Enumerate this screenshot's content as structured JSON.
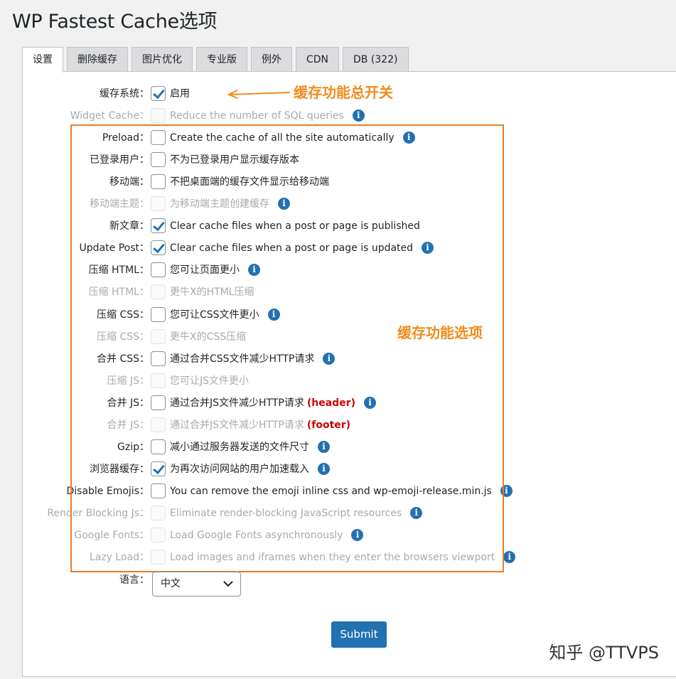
{
  "title": "WP Fastest Cache选项",
  "tabs": [
    {
      "label": "设置",
      "active": true
    },
    {
      "label": "删除缓存"
    },
    {
      "label": "图片优化"
    },
    {
      "label": "专业版"
    },
    {
      "label": "例外"
    },
    {
      "label": "CDN"
    },
    {
      "label": "DB (322)"
    }
  ],
  "rows": [
    {
      "label": "缓存系统：",
      "desc": "启用",
      "checked": true,
      "info": false,
      "disabled": false
    },
    {
      "label": "Widget Cache：",
      "desc": "Reduce the number of SQL queries",
      "checked": false,
      "info": true,
      "disabled": true
    },
    {
      "label": "Preload：",
      "desc": "Create the cache of all the site automatically",
      "checked": false,
      "info": true,
      "disabled": false
    },
    {
      "label": "已登录用户：",
      "desc": "不为已登录用户显示缓存版本",
      "checked": false,
      "info": false,
      "disabled": false
    },
    {
      "label": "移动端：",
      "desc": "不把桌面端的缓存文件显示给移动端",
      "checked": false,
      "info": false,
      "disabled": false
    },
    {
      "label": "移动端主题：",
      "desc": "为移动端主题创建缓存",
      "checked": false,
      "info": true,
      "disabled": true
    },
    {
      "label": "新文章：",
      "desc": "Clear cache files when a post or page is published",
      "checked": true,
      "info": false,
      "disabled": false
    },
    {
      "label": "Update Post：",
      "desc": "Clear cache files when a post or page is updated",
      "checked": true,
      "info": true,
      "disabled": false
    },
    {
      "label": "压缩 HTML：",
      "desc": "您可让页面更小",
      "checked": false,
      "info": true,
      "disabled": false
    },
    {
      "label": "压缩 HTML：",
      "desc": "更牛X的HTML压缩",
      "checked": false,
      "info": false,
      "disabled": true
    },
    {
      "label": "压缩 CSS：",
      "desc": "您可让CSS文件更小",
      "checked": false,
      "info": true,
      "disabled": false
    },
    {
      "label": "压缩 CSS：",
      "desc": "更牛X的CSS压缩",
      "checked": false,
      "info": false,
      "disabled": true
    },
    {
      "label": "合并 CSS：",
      "desc": "通过合并CSS文件减少HTTP请求",
      "checked": false,
      "info": true,
      "disabled": false
    },
    {
      "label": "压缩 JS：",
      "desc": "您可让JS文件更小",
      "checked": false,
      "info": false,
      "disabled": true
    },
    {
      "label": "合并 JS：",
      "desc": "通过合并JS文件减少HTTP请求",
      "tag": "(header)",
      "checked": false,
      "info": true,
      "disabled": false
    },
    {
      "label": "合并 JS：",
      "desc": "通过合并JS文件减少HTTP请求",
      "tag": "(footer)",
      "checked": false,
      "info": false,
      "disabled": true
    },
    {
      "label": "Gzip：",
      "desc": "减小通过服务器发送的文件尺寸",
      "checked": false,
      "info": true,
      "disabled": false
    },
    {
      "label": "浏览器缓存：",
      "desc": "为再次访问网站的用户加速载入",
      "checked": true,
      "info": true,
      "disabled": false
    },
    {
      "label": "Disable Emojis：",
      "desc": "You can remove the emoji inline css and wp-emoji-release.min.js",
      "checked": false,
      "info": true,
      "disabled": false
    },
    {
      "label": "Render Blocking Js：",
      "desc": "Eliminate render-blocking JavaScript resources",
      "checked": false,
      "info": true,
      "disabled": true
    },
    {
      "label": "Google Fonts：",
      "desc": "Load Google Fonts asynchronously",
      "checked": false,
      "info": true,
      "disabled": true
    },
    {
      "label": "Lazy Load：",
      "desc": "Load images and iframes when they enter the browsers viewport",
      "checked": false,
      "info": true,
      "disabled": true
    }
  ],
  "language": {
    "label": "语言：",
    "value": "中文"
  },
  "submit_label": "Submit",
  "annotations": {
    "master_switch": "缓存功能总开关",
    "options": "缓存功能选项"
  },
  "watermark": "知乎 @TTVPS",
  "colors": {
    "accent": "#2271b1",
    "annotation": "#f08c1e",
    "tag_red": "#cc0000"
  }
}
